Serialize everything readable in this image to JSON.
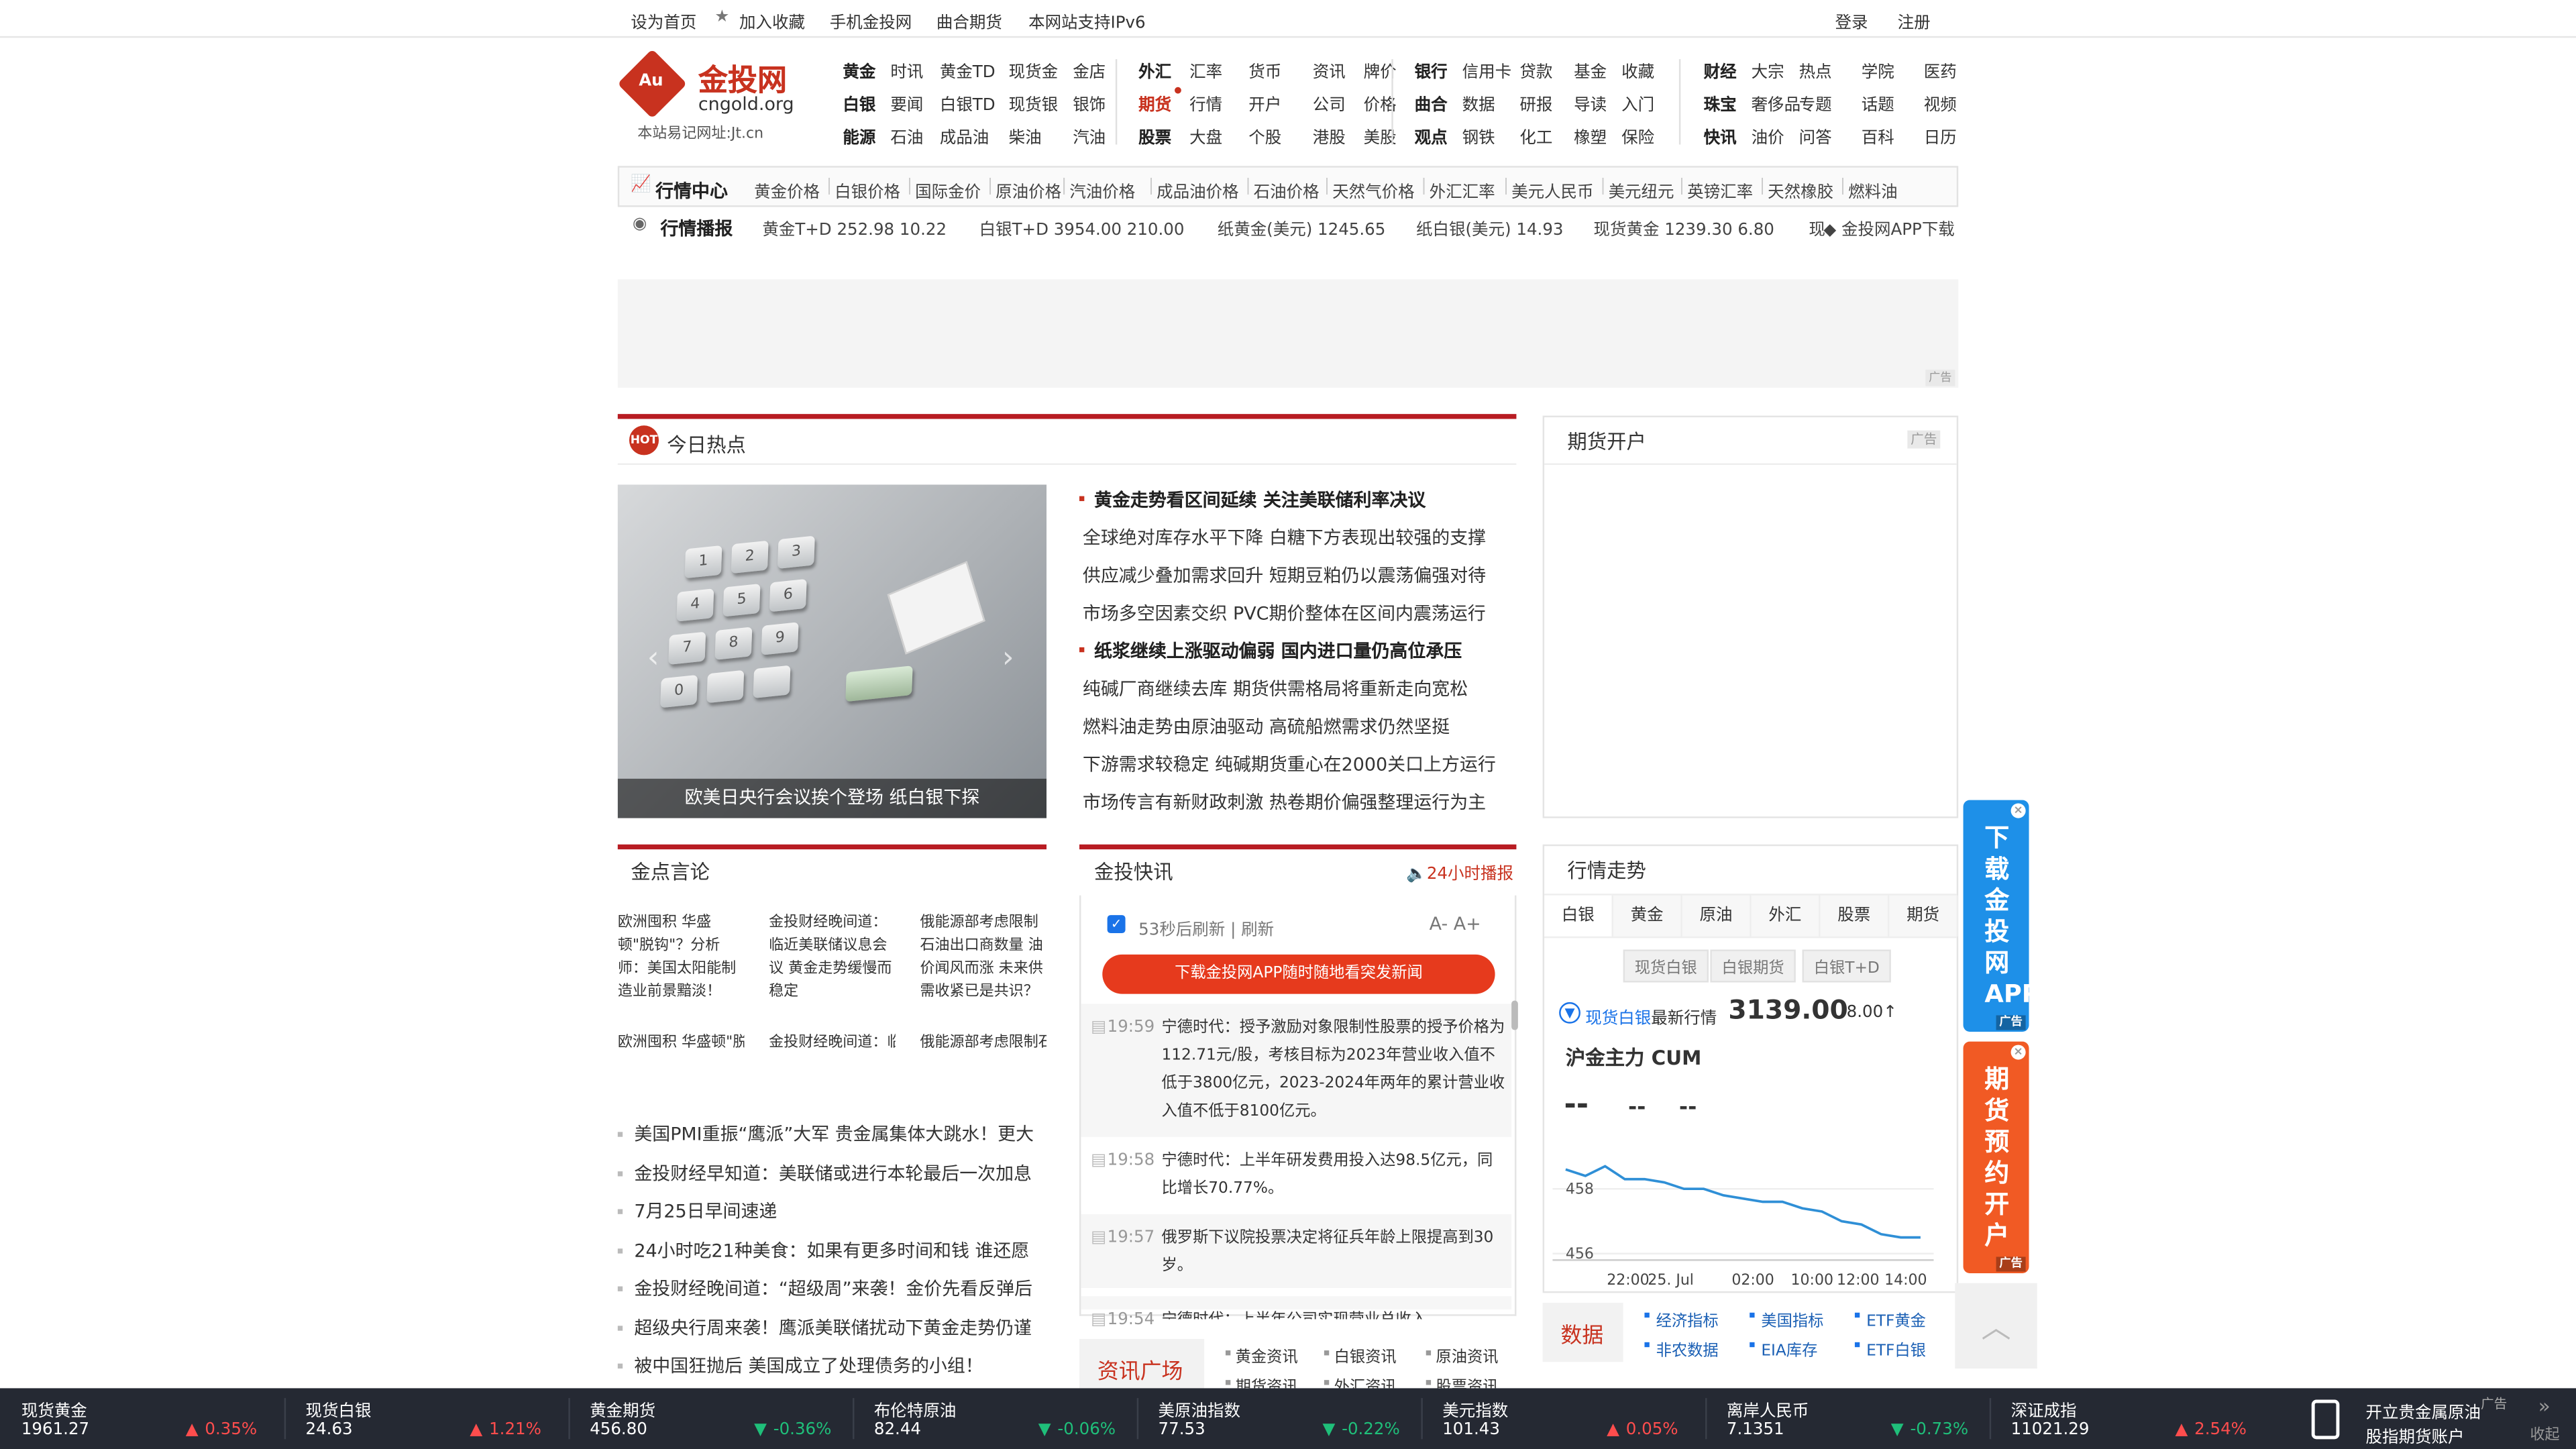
{
  "topbar": {
    "home": "设为首页",
    "fav": "加入收藏",
    "mobile": "手机金投网",
    "qufu": "曲合期货",
    "ipv6": "本网站支持IPv6",
    "login": "登录",
    "register": "注册"
  },
  "logo": {
    "cn": "金投网",
    "en": "cngold.org",
    "badge": "Au",
    "url": "本站易记网址:Jt.cn"
  },
  "nav": [
    [
      "黄金",
      "时讯",
      "黄金TD",
      "现货金",
      "金店"
    ],
    [
      "白银",
      "要闻",
      "白银TD",
      "现货银",
      "银饰"
    ],
    [
      "能源",
      "石油",
      "成品油",
      "柴油",
      "汽油"
    ],
    [
      "外汇",
      "汇率",
      "货币",
      "资讯",
      "牌价"
    ],
    [
      "期货",
      "行情",
      "开户",
      "公司",
      "价格"
    ],
    [
      "股票",
      "大盘",
      "个股",
      "港股",
      "美股"
    ],
    [
      "银行",
      "信用卡",
      "贷款",
      "基金",
      "收藏"
    ],
    [
      "曲合",
      "数据",
      "研报",
      "导读",
      "入门"
    ],
    [
      "观点",
      "钢铁",
      "化工",
      "橡塑",
      "保险"
    ],
    [
      "财经",
      "大宗",
      "热点",
      "学院",
      "医药"
    ],
    [
      "珠宝",
      "奢侈品",
      "专题",
      "话题",
      "视频"
    ],
    [
      "快讯",
      "油价",
      "问答",
      "百科",
      "日历"
    ]
  ],
  "quote_center": {
    "title": "行情中心",
    "links": [
      "黄金价格",
      "白银价格",
      "国际金价",
      "原油价格",
      "汽油价格",
      "成品油价格",
      "石油价格",
      "天然气价格",
      "外汇汇率",
      "美元人民币",
      "美元纽元",
      "英镑汇率",
      "天然橡胶",
      "燃料油"
    ]
  },
  "ticker": {
    "title": "行情播报",
    "items": [
      "黄金T+D  252.98  10.22",
      "白银T+D  3954.00  210.00",
      "纸黄金(美元)  1245.65",
      "纸白银(美元)  14.93",
      "现货黄金  1239.30  6.80",
      "现"
    ],
    "app": "金投网APP下载"
  },
  "ad_label": "广告",
  "hot": {
    "title": "今日热点",
    "caption": "欧美日央行会议挨个登场 纸白银下探",
    "items": [
      {
        "t": "黄金走势看区间延续 关注美联储利率决议",
        "h": true
      },
      {
        "t": "全球绝对库存水平下降 白糖下方表现出较强的支撑",
        "h": false
      },
      {
        "t": "供应减少叠加需求回升 短期豆粕仍以震荡偏强对待",
        "h": false
      },
      {
        "t": "市场多空因素交织 PVC期价整体在区间内震荡运行",
        "h": false
      },
      {
        "t": "纸浆继续上涨驱动偏弱 国内进口量仍高位承压",
        "h": true
      },
      {
        "t": "纯碱厂商继续去库 期货供需格局将重新走向宽松",
        "h": false
      },
      {
        "t": "燃料油走势由原油驱动 高硫船燃需求仍然坚挺",
        "h": false
      },
      {
        "t": "下游需求较稳定 纯碱期货重心在2000关口上方运行",
        "h": false
      },
      {
        "t": "市场传言有新财政刺激 热卷期价偏强整理运行为主",
        "h": false
      }
    ]
  },
  "futures_open": {
    "title": "期货开户",
    "ad": "广告"
  },
  "jindian": {
    "title": "金点言论",
    "imgs": [
      {
        "alt": "欧洲囤积 华盛顿\"脱钩\"？分析师：美国太阳能制造业前景黯淡！",
        "cap": "欧洲囤积 华盛顿\"脱钩\"？分析"
      },
      {
        "alt": "金投财经晚间道：临近美联储议息会议 黄金走势缓慢而稳定",
        "cap": "金投财经晚间道：临近美联储"
      },
      {
        "alt": "俄能源部考虑限制石油出口商数量 油价闻风而涨 未来供需收紧已是共识？",
        "cap": "俄能源部考虑限制石油出口商数"
      }
    ],
    "list": [
      "美国PMI重振“鹰派”大军 贵金属集体大跳水！更大",
      "金投财经早知道：美联储或进行本轮最后一次加息",
      "7月25日早间速递",
      "24小时吃21种美食：如果有更多时间和钱 谁还愿",
      "金投财经晚间道：“超级周”来袭！金价先看反弹后",
      "超级央行周来袭！鹰派美联储扰动下黄金走势仍谨",
      "被中国狂抛后 美国成立了处理债务的小组！"
    ]
  },
  "kuaixun": {
    "title": "金投快讯",
    "live": "24小时播报",
    "refresh": "53秒后刷新 | 刷新",
    "fontsize": "A-  A+",
    "app_btn": "下载金投网APP随时随地看突发新闻",
    "items": [
      {
        "time": "19:59",
        "text": "宁德时代：授予激励对象限制性股票的授予价格为112.71元/股，考核目标为2023年营业收入值不低于3800亿元，2023-2024年两年的累计营业收入值不低于8100亿元。"
      },
      {
        "time": "19:58",
        "text": "宁德时代：上半年研发费用投入达98.5亿元，同比增长70.77%。"
      },
      {
        "time": "19:57",
        "text": "俄罗斯下议院投票决定将征兵年龄上限提高到30岁。"
      },
      {
        "time": "19:54",
        "text": "宁德时代：上半年公司实现营业总收入"
      }
    ]
  },
  "trend": {
    "title": "行情走势",
    "tabs": [
      "白银",
      "黄金",
      "原油",
      "外汇",
      "股票",
      "期货"
    ],
    "subtabs": [
      "现货白银",
      "白银期货",
      "白银T+D"
    ],
    "label": "现货白银",
    "label2": "最新行情",
    "price": "3139.00",
    "change": "8.00↑",
    "contract": "沪金主力   CUM",
    "dashes": [
      "--",
      "--",
      "--"
    ]
  },
  "chart_data": {
    "type": "line",
    "x": [
      "22:00",
      "25. Jul",
      "02:00",
      "10:00",
      "12:00",
      "14:00"
    ],
    "y_ticks": [
      458,
      456
    ],
    "ylim": [
      455.8,
      459.2
    ],
    "values": [
      458.6,
      458.4,
      458.7,
      458.3,
      458.3,
      458.2,
      458.0,
      458.0,
      457.8,
      457.7,
      457.6,
      457.6,
      457.4,
      457.3,
      457.0,
      456.9,
      456.6,
      456.5,
      456.5
    ]
  },
  "data_box": {
    "title": "数据",
    "links": [
      "经济指标",
      "美国指标",
      "ETF黄金",
      "非农数据",
      "EIA库存",
      "ETF白银"
    ]
  },
  "news_square": {
    "title": "资讯广场",
    "links": [
      "黄金资讯",
      "白银资讯",
      "原油资讯",
      "期货资讯",
      "外汇资讯",
      "股票资讯"
    ]
  },
  "side_ads": [
    {
      "text": "下载金投网APP",
      "tag": "广告"
    },
    {
      "text": "期货预约开户",
      "tag": "广告"
    }
  ],
  "bottom": [
    {
      "name": "现货黄金",
      "value": "1961.27",
      "chg": "0.35%",
      "dir": "up"
    },
    {
      "name": "现货白银",
      "value": "24.63",
      "chg": "1.21%",
      "dir": "up"
    },
    {
      "name": "黄金期货",
      "value": "456.80",
      "chg": "-0.36%",
      "dir": "down"
    },
    {
      "name": "布伦特原油",
      "value": "82.44",
      "chg": "-0.06%",
      "dir": "down"
    },
    {
      "name": "美原油指数",
      "value": "77.53",
      "chg": "-0.22%",
      "dir": "down"
    },
    {
      "name": "美元指数",
      "value": "101.43",
      "chg": "0.05%",
      "dir": "up"
    },
    {
      "name": "离岸人民币",
      "value": "7.1351",
      "chg": "-0.73%",
      "dir": "down"
    },
    {
      "name": "深证成指",
      "value": "11021.29",
      "chg": "2.54%",
      "dir": "up"
    }
  ],
  "bottom_ad": {
    "line1": "开立贵金属原油",
    "line2": "股指期货账户",
    "tag": "广告",
    "collapse": "收起"
  }
}
